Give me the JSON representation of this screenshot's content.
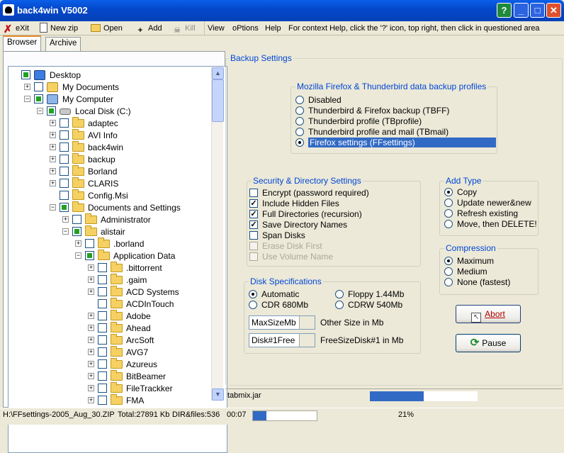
{
  "window": {
    "title": "back4win V5002",
    "buttons": [
      "?",
      "_",
      "□",
      "✕"
    ]
  },
  "menu": {
    "exit": "eXit",
    "newzip": "New zip",
    "open": "Open",
    "add": "Add",
    "kill": "Kill",
    "view": "View",
    "options": "oPtions",
    "help": "Help",
    "context_help": "For context Help, click the '?' icon, top right, then click in questioned area"
  },
  "tabs": {
    "browser": "Browser",
    "archive": "Archive"
  },
  "tree": [
    {
      "label": "Desktop",
      "depth": 0,
      "exp": "",
      "chk": "part",
      "icon": "desktop"
    },
    {
      "label": "My Documents",
      "depth": 1,
      "exp": "+",
      "chk": "",
      "icon": "docs"
    },
    {
      "label": "My Computer",
      "depth": 1,
      "exp": "-",
      "chk": "part",
      "icon": "computer"
    },
    {
      "label": "Local Disk (C:)",
      "depth": 2,
      "exp": "-",
      "chk": "part",
      "icon": "disk"
    },
    {
      "label": "adaptec",
      "depth": 3,
      "exp": "+",
      "chk": "",
      "icon": "folder"
    },
    {
      "label": "AVI Info",
      "depth": 3,
      "exp": "+",
      "chk": "",
      "icon": "folder"
    },
    {
      "label": "back4win",
      "depth": 3,
      "exp": "+",
      "chk": "",
      "icon": "folder"
    },
    {
      "label": "backup",
      "depth": 3,
      "exp": "+",
      "chk": "",
      "icon": "folder"
    },
    {
      "label": "Borland",
      "depth": 3,
      "exp": "+",
      "chk": "",
      "icon": "folder"
    },
    {
      "label": "CLARIS",
      "depth": 3,
      "exp": "+",
      "chk": "",
      "icon": "folder"
    },
    {
      "label": "Config.Msi",
      "depth": 3,
      "exp": "",
      "chk": "",
      "icon": "folder"
    },
    {
      "label": "Documents and Settings",
      "depth": 3,
      "exp": "-",
      "chk": "part",
      "icon": "folder"
    },
    {
      "label": "Administrator",
      "depth": 4,
      "exp": "+",
      "chk": "",
      "icon": "folder"
    },
    {
      "label": "alistair",
      "depth": 4,
      "exp": "-",
      "chk": "part",
      "icon": "folder"
    },
    {
      "label": ".borland",
      "depth": 5,
      "exp": "+",
      "chk": "",
      "icon": "folder"
    },
    {
      "label": "Application Data",
      "depth": 5,
      "exp": "-",
      "chk": "part",
      "icon": "folder"
    },
    {
      "label": ".bittorrent",
      "depth": 6,
      "exp": "+",
      "chk": "",
      "icon": "folder"
    },
    {
      "label": ".gaim",
      "depth": 6,
      "exp": "+",
      "chk": "",
      "icon": "folder"
    },
    {
      "label": "ACD Systems",
      "depth": 6,
      "exp": "+",
      "chk": "",
      "icon": "folder"
    },
    {
      "label": "ACDInTouch",
      "depth": 6,
      "exp": "",
      "chk": "",
      "icon": "folder"
    },
    {
      "label": "Adobe",
      "depth": 6,
      "exp": "+",
      "chk": "",
      "icon": "folder"
    },
    {
      "label": "Ahead",
      "depth": 6,
      "exp": "+",
      "chk": "",
      "icon": "folder"
    },
    {
      "label": "ArcSoft",
      "depth": 6,
      "exp": "+",
      "chk": "",
      "icon": "folder"
    },
    {
      "label": "AVG7",
      "depth": 6,
      "exp": "+",
      "chk": "",
      "icon": "folder"
    },
    {
      "label": "Azureus",
      "depth": 6,
      "exp": "+",
      "chk": "",
      "icon": "folder"
    },
    {
      "label": "BitBeamer",
      "depth": 6,
      "exp": "+",
      "chk": "",
      "icon": "folder"
    },
    {
      "label": "FileTrackker",
      "depth": 6,
      "exp": "+",
      "chk": "",
      "icon": "folder"
    },
    {
      "label": "FMA",
      "depth": 6,
      "exp": "+",
      "chk": "",
      "icon": "folder"
    }
  ],
  "backup_settings": {
    "title": "Backup Settings"
  },
  "mozilla": {
    "title": "Mozilla Firefox & Thunderbird data backup profiles",
    "options": [
      "Disabled",
      "Thunderbird & Firefox backup (TBFF)",
      "Thunderbird profile (TBprofile)",
      "Thunderbird profile and mail (TBmail)",
      "Firefox settings (FFsettings)"
    ],
    "selected": 4
  },
  "security": {
    "title": "Security & Directory Settings",
    "options": [
      {
        "label": "Encrypt (password required)",
        "checked": false,
        "disabled": false
      },
      {
        "label": "Include Hidden Files",
        "checked": true,
        "disabled": false
      },
      {
        "label": "Full Directories (recursion)",
        "checked": true,
        "disabled": false
      },
      {
        "label": "Save Directory Names",
        "checked": true,
        "disabled": false
      },
      {
        "label": "Span Disks",
        "checked": false,
        "disabled": false
      },
      {
        "label": "Erase Disk First",
        "checked": false,
        "disabled": true
      },
      {
        "label": "Use Volume Name",
        "checked": false,
        "disabled": true
      }
    ]
  },
  "add_type": {
    "title": "Add Type",
    "options": [
      "Copy",
      "Update newer&new",
      "Refresh existing",
      "Move, then DELETE!"
    ],
    "selected": 0
  },
  "compression": {
    "title": "Compression",
    "options": [
      "Maximum",
      "Medium",
      "None (fastest)"
    ],
    "selected": 0
  },
  "disk": {
    "title": "Disk Specifications",
    "options": [
      "Automatic",
      "Floppy 1.44Mb",
      "CDR 680Mb",
      "CDRW 540Mb"
    ],
    "selected": 0,
    "maxsize_value": "MaxSizeMb",
    "maxsize_label": "Other Size in Mb",
    "free_value": "Disk#1Free",
    "free_label": "FreeSizeDisk#1 in Mb"
  },
  "buttons": {
    "abort": "Abort",
    "pause": "Pause"
  },
  "current_file": "tabmix.jar",
  "file_progress": 0.5,
  "status": {
    "path": "H:\\FFsettings-2005_Aug_30.ZIP",
    "total": "Total:27891 Kb",
    "dirfiles": "DIR&files:536",
    "time": "00:07",
    "percent": "21%",
    "progress": 0.21
  },
  "colors": {
    "title_bar": "#0553d8",
    "group_title": "#0046d5",
    "selection": "#316ac5",
    "progress": "#316ac5"
  }
}
